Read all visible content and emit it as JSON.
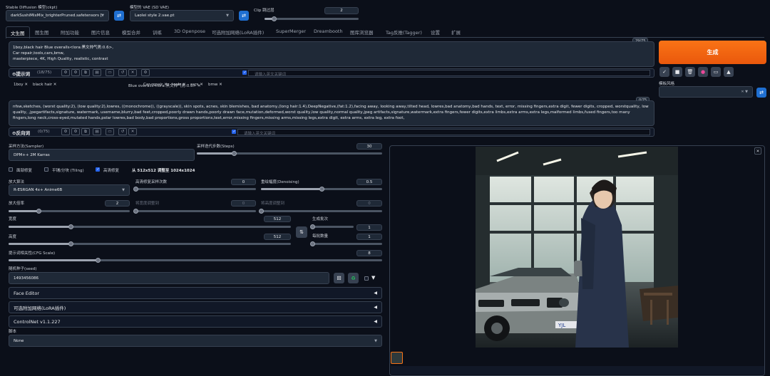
{
  "header": {
    "model_label": "Stable Diffusion 模型(ckpt)",
    "model_value": "darkSushiMixMix_brighterPruned.safetensors [",
    "vae_label": "模型的 VAE (SD VAE)",
    "vae_value": "Laolei style 2.vae.pt",
    "clip_label": "Clip 跳过层",
    "clip_value": "2",
    "clip_fraction": 0.1
  },
  "tabs": [
    "文生图",
    "图生图",
    "附加功能",
    "图片信息",
    "模型合并",
    "训练",
    "3D Openpose",
    "可选附加网络(LoRA插件)",
    "SuperMerger",
    "Dreambooth",
    "图库浏览器",
    "Tag反推(Tagger)",
    "设置",
    "扩展"
  ],
  "prompt": {
    "counter": "29/75",
    "text": [
      "1boy,black hair  Blue overalls<lora:黑文帅气男:0.6>,",
      "Car repair,tools,cars,bmw,",
      "masterpiece, 4K, High Quality, realistic, contrast"
    ],
    "label": "提示词",
    "count": "(18/75)",
    "search_placeholder": "请输入英文关键词",
    "chips": [
      "1boy",
      "black hair",
      "Blue overalls<lora:黑文帅气男:0.6>",
      "Car repair",
      "tools",
      "cars",
      "bmw"
    ]
  },
  "negative": {
    "counter": "0/75",
    "text": "nfsw,sketches, (worst quality:2), (low quality:2),lowres, ((monochrome)), ((grayscale)), skin spots, acnes, skin blemishes, bad anatomy,(long hair:1.4),DeepNegative,(fat:1.2),facing away, looking away,tilted head, lowres,bad anatomy,bad hands, text, error, missing fingers,extra digit, fewer digits, cropped, worstquality, low quality, ,jpegartifacts,signature, watermark, username,blurry,bad feet,cropped,poorly drawn hands,poorly drawn face,mutation,deformed,worst quality,low quality,normal quality,jpeg artifacts,signature,watermark,extra fingers,fewer digits,extra limbs,extra arms,extra legs,malformed limbs,fused fingers,too many fingers,long neck,cross-eyed,mutated hands,polar lowres,bad body,bad proportions,gross proportions,text,error,missing fingers,missing arms,missing legs,extra digit, extra arms, extra leg, extra foot,",
    "label": "反向词",
    "count": "(0/75)",
    "search_placeholder": "请输入英文关键词"
  },
  "generate": {
    "label": "生成",
    "style_label": "模板风格"
  },
  "sampler": {
    "label": "采样方法(Sampler)",
    "value": "DPM++ 2M Karras",
    "steps_label": "采样迭代步数(Steps)",
    "steps": "30",
    "steps_fraction": 0.2
  },
  "checks": {
    "face": "面部修复",
    "tiling": "平铺/分块 (Tiling)",
    "hires": "高清修复",
    "hires_info": "从 512x512 调整至 1024x1024"
  },
  "hires": {
    "upscaler_label": "放大算法",
    "upscaler": "R-ESRGAN 4x+ Anime6B",
    "hires_steps_label": "高清修复采样次数",
    "hires_steps": "0",
    "hires_steps_fraction": 0,
    "denoise_label": "重绘幅度(Denoising)",
    "denoise": "0.5",
    "denoise_fraction": 0.5,
    "scale_label": "放大倍率",
    "scale": "2",
    "scale_fraction": 0.25,
    "resize_w_label": "将宽度调整到",
    "resize_w": "0",
    "resize_h_label": "将高度调整到",
    "resize_h": "0"
  },
  "size": {
    "width_label": "宽度",
    "width": "512",
    "width_fraction": 0.22,
    "height_label": "高度",
    "height": "512",
    "height_fraction": 0.22,
    "batch_count_label": "生成批次",
    "batch_count": "1",
    "batch_size_label": "每批数量",
    "batch_size": "1"
  },
  "cfg": {
    "label": "提示词相关性(CFG Scale)",
    "value": "8",
    "fraction": 0.24
  },
  "seed": {
    "label": "随机种子(seed)",
    "value": "1493456086"
  },
  "accordions": [
    "Face Editor",
    "可选附加网络(LoRA插件)",
    "ControlNet v1.1.227"
  ],
  "script": {
    "label": "脚本",
    "value": "None"
  },
  "colors": {
    "accent": "#ea580c",
    "blue": "#1f6fd1",
    "bg": "#0b0f19",
    "panel": "#1f2937"
  }
}
